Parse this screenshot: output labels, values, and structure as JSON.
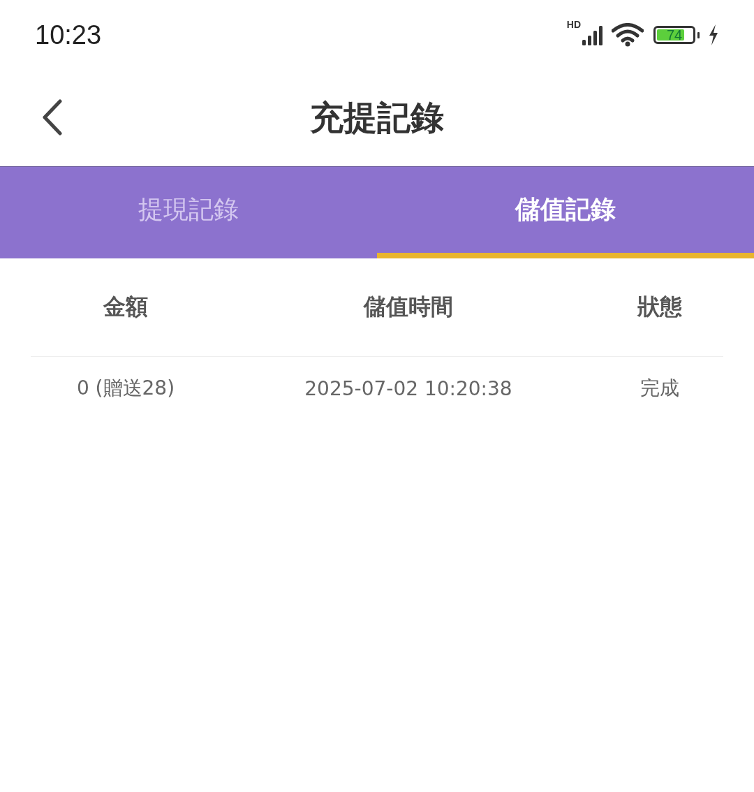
{
  "status_bar": {
    "time": "10:23",
    "network": "HD",
    "battery": "74"
  },
  "header": {
    "title": "充提記錄"
  },
  "tabs": [
    {
      "label": "提現記錄",
      "selected": false
    },
    {
      "label": "儲值記錄",
      "selected": true
    }
  ],
  "table": {
    "columns": [
      "金額",
      "儲值時間",
      "狀態"
    ],
    "rows": [
      [
        "0 (贈送28)",
        "2025-07-02 10:20:38",
        "完成"
      ]
    ]
  }
}
